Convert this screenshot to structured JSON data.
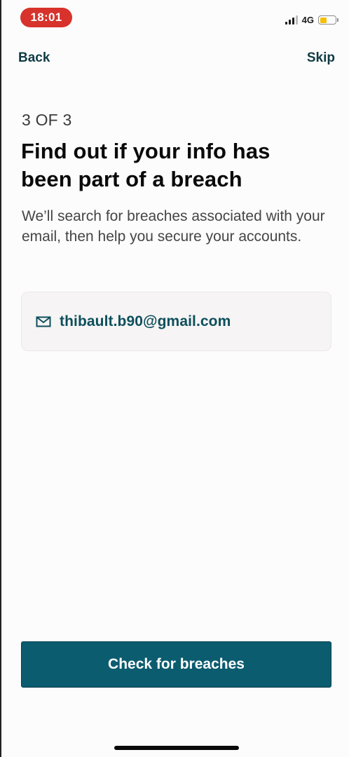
{
  "status_bar": {
    "time": "18:01",
    "network": "4G",
    "battery_level": 0.45,
    "colors": {
      "time_pill": "#d7322b",
      "battery_fill": "#f3c000"
    }
  },
  "nav": {
    "back_label": "Back",
    "skip_label": "Skip"
  },
  "main": {
    "step": "3 OF 3",
    "title": "Find out if your info has been part of a breach",
    "subtitle": "We’ll search for breaches associated with your email, then help you secure your accounts.",
    "email": {
      "icon": "mail-icon",
      "value": "thibault.b90@gmail.com"
    }
  },
  "cta": {
    "label": "Check for breaches",
    "color": "#0b5c6f"
  }
}
